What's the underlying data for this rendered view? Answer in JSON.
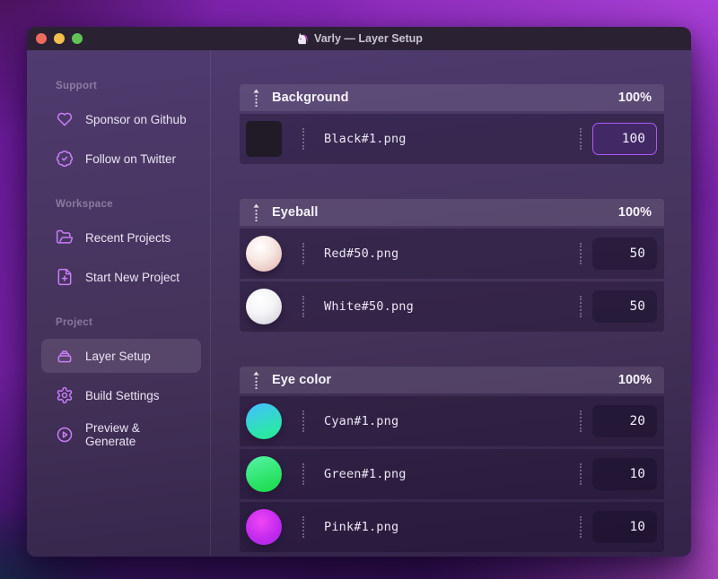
{
  "window": {
    "title": "Varly — Layer Setup"
  },
  "sidebar": {
    "sections": [
      {
        "label": "Support",
        "items": [
          {
            "icon": "heart-icon",
            "label": "Sponsor on Github"
          },
          {
            "icon": "badge-check-icon",
            "label": "Follow on Twitter"
          }
        ]
      },
      {
        "label": "Workspace",
        "items": [
          {
            "icon": "folder-open-icon",
            "label": "Recent Projects"
          },
          {
            "icon": "file-plus-icon",
            "label": "Start New Project"
          }
        ]
      },
      {
        "label": "Project",
        "items": [
          {
            "icon": "archive-box-icon",
            "label": "Layer Setup",
            "selected": true
          },
          {
            "icon": "gear-icon",
            "label": "Build Settings"
          },
          {
            "icon": "play-circle-icon",
            "label": "Preview & Generate"
          }
        ]
      }
    ]
  },
  "layers": {
    "groups": [
      {
        "name": "Background",
        "total": "100%",
        "rows": [
          {
            "thumb": "black-square",
            "file": "Black#1.png",
            "value": "100",
            "focused": true
          }
        ]
      },
      {
        "name": "Eyeball",
        "total": "100%",
        "rows": [
          {
            "thumb": "red-sphere",
            "file": "Red#50.png",
            "value": "50"
          },
          {
            "thumb": "white-sphere",
            "file": "White#50.png",
            "value": "50"
          }
        ]
      },
      {
        "name": "Eye color",
        "total": "100%",
        "rows": [
          {
            "thumb": "cyan-gradient",
            "file": "Cyan#1.png",
            "value": "20"
          },
          {
            "thumb": "green-gradient",
            "file": "Green#1.png",
            "value": "10"
          },
          {
            "thumb": "pink-gradient",
            "file": "Pink#1.png",
            "value": "10"
          }
        ]
      }
    ]
  },
  "colors": {
    "accent": "#c97ef7",
    "focus_border": "#ac5bf6",
    "traffic_red": "#ee6a5e",
    "traffic_yellow": "#f4bf4e",
    "traffic_green": "#5fc454"
  }
}
